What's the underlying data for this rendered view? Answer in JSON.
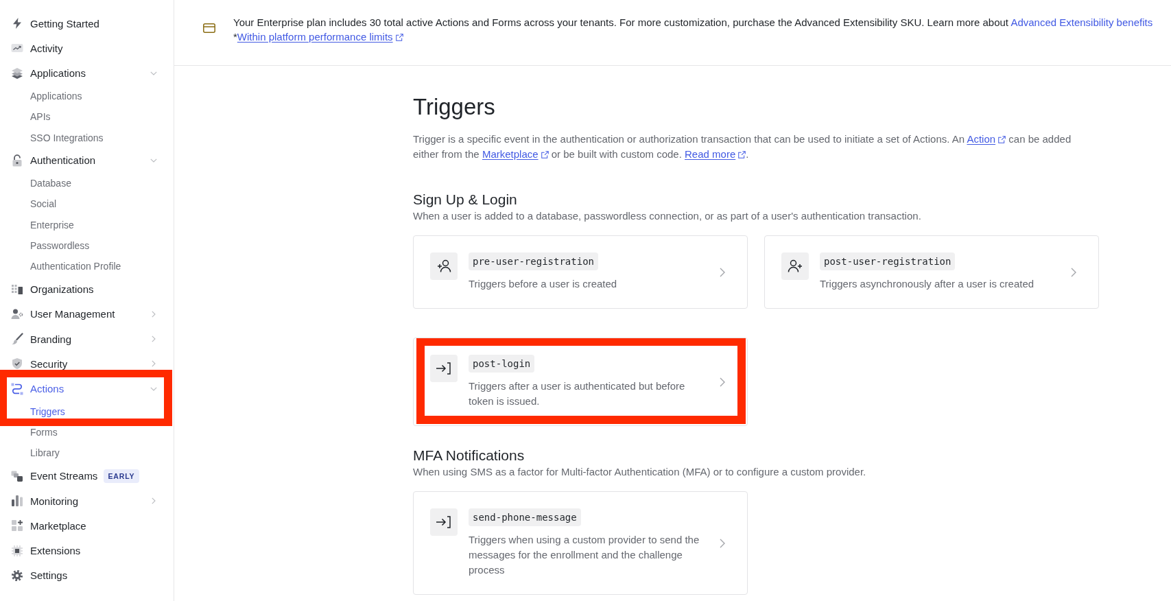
{
  "sidebar": {
    "items": [
      {
        "label": "Getting Started",
        "kind": "link",
        "selected": false,
        "highlighted": false
      },
      {
        "label": "Activity",
        "kind": "link",
        "selected": false,
        "highlighted": false
      },
      {
        "label": "Applications",
        "kind": "group",
        "selected": false,
        "expanded": true,
        "highlighted": false,
        "children": [
          {
            "label": "Applications",
            "selected": false,
            "highlighted": false
          },
          {
            "label": "APIs",
            "selected": false,
            "highlighted": false
          },
          {
            "label": "SSO Integrations",
            "selected": false,
            "highlighted": false
          }
        ]
      },
      {
        "label": "Authentication",
        "kind": "group",
        "selected": false,
        "expanded": true,
        "highlighted": false,
        "children": [
          {
            "label": "Database",
            "selected": false,
            "highlighted": false
          },
          {
            "label": "Social",
            "selected": false,
            "highlighted": false
          },
          {
            "label": "Enterprise",
            "selected": false,
            "highlighted": false
          },
          {
            "label": "Passwordless",
            "selected": false,
            "highlighted": false
          },
          {
            "label": "Authentication Profile",
            "selected": false,
            "highlighted": false
          }
        ]
      },
      {
        "label": "Organizations",
        "kind": "link",
        "selected": false,
        "highlighted": false
      },
      {
        "label": "User Management",
        "kind": "group",
        "selected": false,
        "expanded": false,
        "highlighted": false
      },
      {
        "label": "Branding",
        "kind": "group",
        "selected": false,
        "expanded": false,
        "highlighted": false
      },
      {
        "label": "Security",
        "kind": "group",
        "selected": false,
        "expanded": false,
        "highlighted": false
      },
      {
        "label": "Actions",
        "kind": "group",
        "selected": true,
        "expanded": true,
        "highlighted": true,
        "children": [
          {
            "label": "Triggers",
            "selected": true,
            "highlighted": true
          },
          {
            "label": "Forms",
            "selected": false,
            "highlighted": false
          },
          {
            "label": "Library",
            "selected": false,
            "highlighted": false
          }
        ]
      },
      {
        "label": "Event Streams",
        "kind": "link",
        "selected": false,
        "highlighted": false,
        "badge": "EARLY"
      },
      {
        "label": "Monitoring",
        "kind": "group",
        "selected": false,
        "expanded": false,
        "highlighted": false
      },
      {
        "label": "Marketplace",
        "kind": "link",
        "selected": false,
        "highlighted": false
      },
      {
        "label": "Extensions",
        "kind": "link",
        "selected": false,
        "highlighted": false
      },
      {
        "label": "Settings",
        "kind": "link",
        "selected": false,
        "highlighted": false
      }
    ]
  },
  "banner": {
    "text": [
      {
        "kind": "text",
        "text": "Your Enterprise plan includes 30 total active Actions and Forms across your tenants. For more customization, purchase the Advanced Extensibility SKU. Learn more about "
      },
      {
        "kind": "link",
        "text": "Advanced Extensibility benefits"
      }
    ],
    "footnote": [
      {
        "kind": "text",
        "text": "*"
      },
      {
        "kind": "external-link",
        "text": "Within platform performance limits"
      }
    ]
  },
  "page": {
    "title": "Triggers",
    "description": [
      {
        "kind": "text",
        "text": "Trigger is a specific event in the authentication or authorization transaction that can be used to initiate a set of Actions. An "
      },
      {
        "kind": "external-link",
        "text": "Action"
      },
      {
        "kind": "text",
        "text": " can be added either from the "
      },
      {
        "kind": "external-link",
        "text": "Marketplace"
      },
      {
        "kind": "text",
        "text": " or be built with custom code. "
      },
      {
        "kind": "external-link",
        "text": "Read more"
      },
      {
        "kind": "text",
        "text": "."
      }
    ],
    "sections": [
      {
        "title": "Sign Up & Login",
        "description": "When a user is added to a database, passwordless connection, or as part of a user's authentication transaction.",
        "triggers": [
          {
            "name": "pre-user-registration",
            "description": "Triggers before a user is created",
            "kind": "add-before",
            "highlighted": false
          },
          {
            "name": "post-user-registration",
            "description": "Triggers asynchronously after a user is created",
            "kind": "add-after",
            "highlighted": false
          },
          {
            "name": "post-login",
            "description": "Triggers after a user is authenticated but before token is issued.",
            "kind": "enter",
            "highlighted": true
          }
        ]
      },
      {
        "title": "MFA Notifications",
        "description": "When using SMS as a factor for Multi-factor Authentication (MFA) or to configure a custom provider.",
        "triggers": [
          {
            "name": "send-phone-message",
            "description": "Triggers when using a custom provider to send the messages for the enrollment and the challenge process",
            "kind": "enter",
            "highlighted": false
          }
        ]
      }
    ]
  }
}
